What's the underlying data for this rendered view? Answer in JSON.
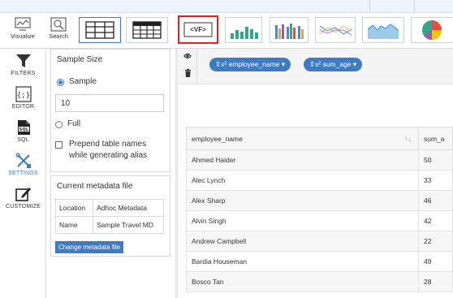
{
  "toolbar": {
    "visualize_label": "Visualize",
    "search_label": "Search",
    "vf_label": "<VF>"
  },
  "rail": {
    "items": [
      {
        "label": "FILTERS",
        "icon": "funnel-icon"
      },
      {
        "label": "EDITOR",
        "icon": "code-braces-icon"
      },
      {
        "label": "SQL",
        "icon": "sql-file-icon"
      },
      {
        "label": "SETTINGS",
        "icon": "tools-icon"
      },
      {
        "label": "CUSTOMIZE",
        "icon": "edit-icon"
      }
    ]
  },
  "settings": {
    "title": "Sample Size",
    "sample_label": "Sample",
    "sample_value": "10",
    "full_label": "Full",
    "prepend_line1": "Prepend table names",
    "prepend_line2": "while generating alias"
  },
  "metadata": {
    "title": "Current metadata file",
    "rows": [
      {
        "key": "Location",
        "value": "Adhoc Metadata"
      },
      {
        "key": "Name",
        "value": "Sample Travel MD"
      }
    ],
    "button_label": "Change metadata file"
  },
  "chips": [
    {
      "label": "⇕x² employee_name ▾"
    },
    {
      "label": "⇕x² sum_age ▾"
    }
  ],
  "grid": {
    "columns": [
      "employee_name",
      "sum_a"
    ],
    "rows": [
      {
        "name": "Ahmed Haider",
        "value": "50"
      },
      {
        "name": "Alec Lynch",
        "value": "33"
      },
      {
        "name": "Alex Sharp",
        "value": "46"
      },
      {
        "name": "Alvin Singh",
        "value": "42"
      },
      {
        "name": "Andrew Campbell",
        "value": "22"
      },
      {
        "name": "Bardia Houseman",
        "value": "49"
      },
      {
        "name": "Bosco Tan",
        "value": "28"
      }
    ]
  },
  "colors": {
    "accent": "#3d7cc4",
    "highlight_border": "#e02020"
  }
}
